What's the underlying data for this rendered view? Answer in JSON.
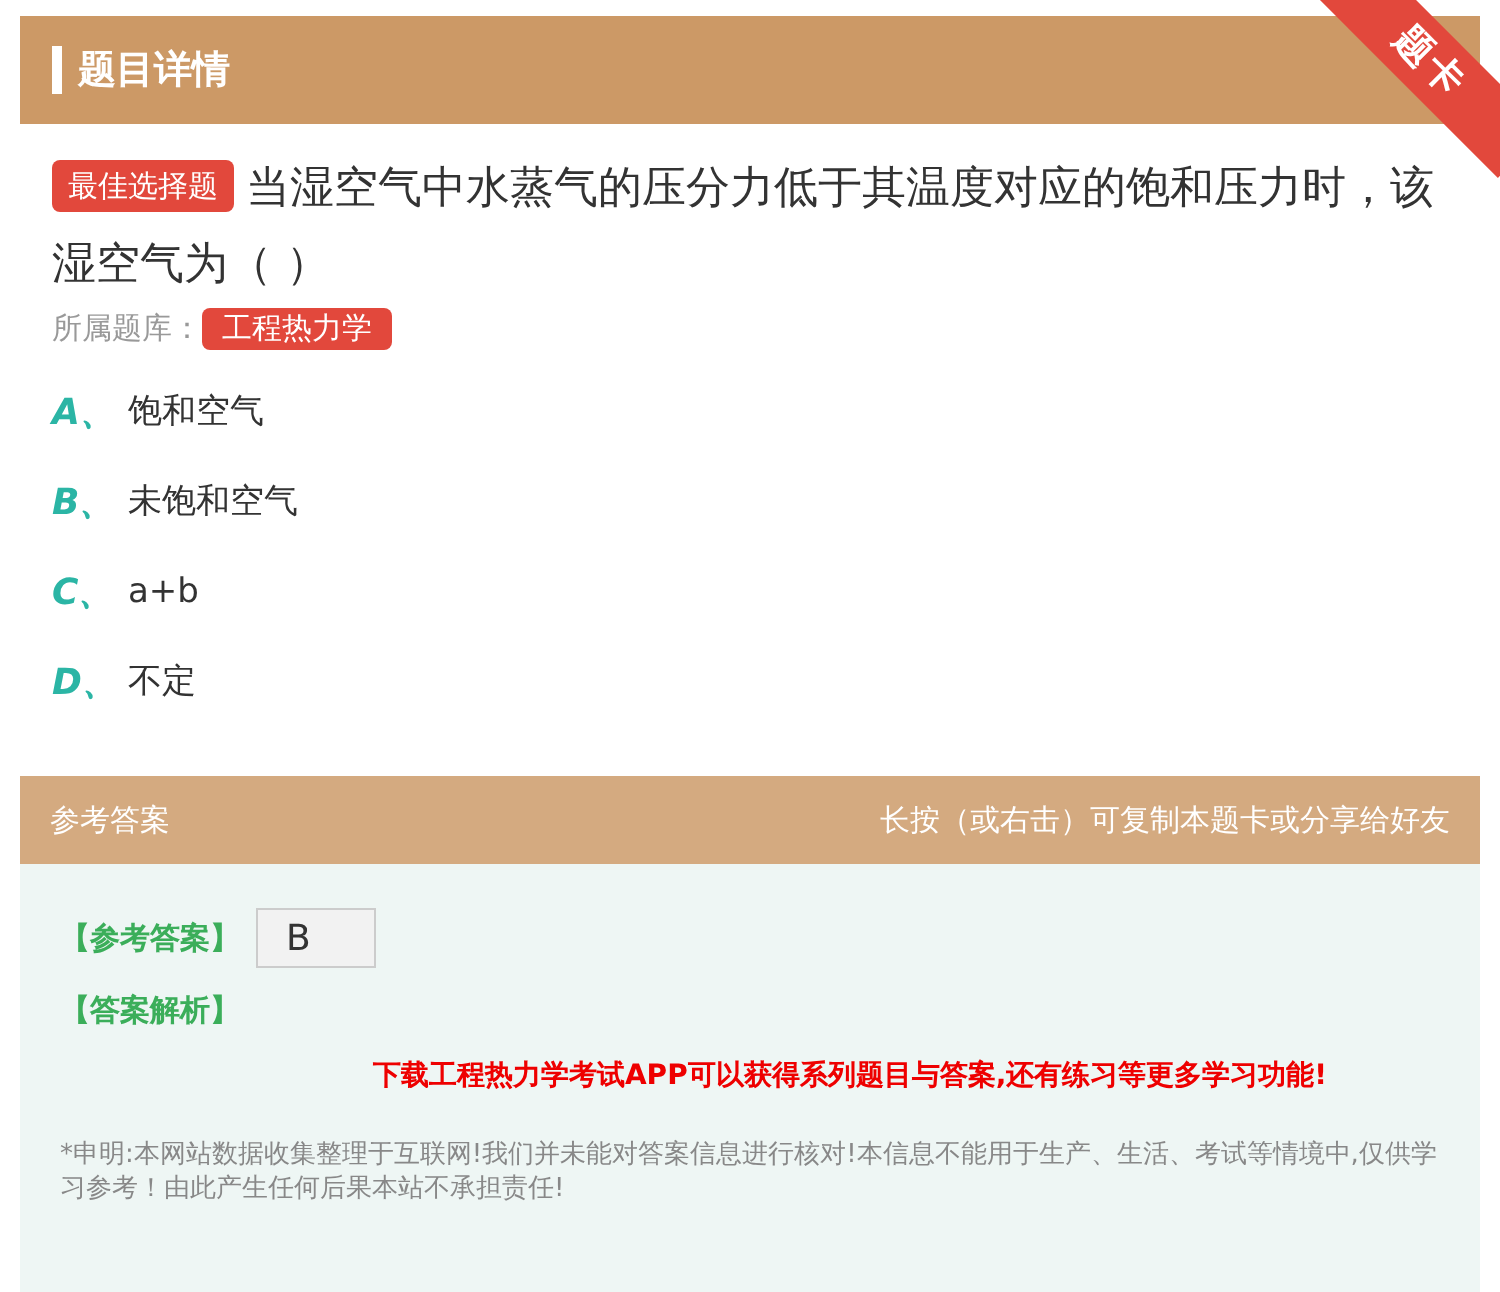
{
  "header": {
    "title": "题目详情",
    "ribbon": "题卡"
  },
  "question": {
    "type_tag": "最佳选择题",
    "text": "当湿空气中水蒸气的压分力低于其温度对应的饱和压力时，该湿空气为（ ）",
    "bank_label": "所属题库：",
    "bank_tag": "工程热力学"
  },
  "options": [
    {
      "letter": "A、",
      "text": "饱和空气"
    },
    {
      "letter": "B、",
      "text": "未饱和空气"
    },
    {
      "letter": "C、",
      "text": "a+b"
    },
    {
      "letter": "D、",
      "text": "不定"
    }
  ],
  "answer_bar": {
    "title": "参考答案",
    "hint": "长按（或右击）可复制本题卡或分享给好友"
  },
  "answer": {
    "label": "【参考答案】",
    "value": "B",
    "analysis_label": "【答案解析】",
    "promo": "下载工程热力学考试APP可以获得系列题目与答案,还有练习等更多学习功能!",
    "disclaimer": "*申明:本网站数据收集整理于互联网!我们并未能对答案信息进行核对!本信息不能用于生产、生活、考试等情境中,仅供学习参考！由此产生任何后果本站不承担责任!"
  }
}
